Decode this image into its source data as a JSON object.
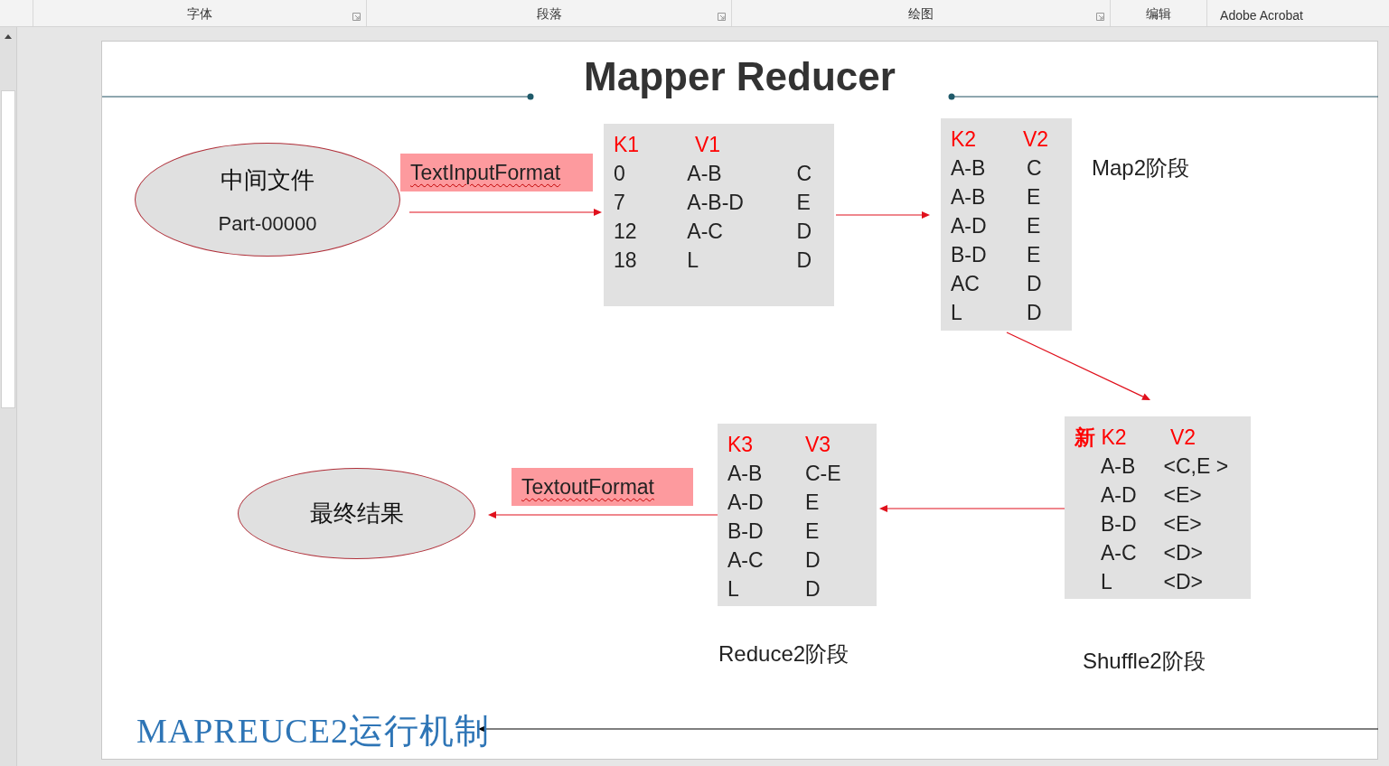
{
  "ribbon": {
    "groups": [
      {
        "label": "字体",
        "launcher": true
      },
      {
        "label": "段落",
        "launcher": true
      },
      {
        "label": "绘图",
        "launcher": true
      },
      {
        "label": "编辑",
        "launcher": false
      },
      {
        "label": "Adobe Acrobat",
        "launcher": false
      }
    ]
  },
  "slide": {
    "title": "Mapper Reducer",
    "ellipses": [
      {
        "title": "中间文件",
        "subtitle": "Part-00000"
      },
      {
        "title": "最终结果"
      }
    ],
    "format_labels": [
      "TextInputFormat",
      "TextoutFormat"
    ],
    "tables": [
      {
        "header": [
          "K1",
          "V1"
        ],
        "rows": [
          [
            "0",
            "A-B",
            "C"
          ],
          [
            "7",
            "A-B-D",
            "E"
          ],
          [
            "12",
            "A-C",
            "D"
          ],
          [
            "18",
            "L",
            "D"
          ]
        ]
      },
      {
        "header": [
          "K2",
          "V2"
        ],
        "rows": [
          [
            "A-B",
            "C"
          ],
          [
            "A-B",
            "E"
          ],
          [
            "A-D",
            "E"
          ],
          [
            "B-D",
            "E"
          ],
          [
            "AC",
            "D"
          ],
          [
            "L",
            "D"
          ]
        ]
      },
      {
        "header": [
          "K3",
          "V3"
        ],
        "rows": [
          [
            "A-B",
            "C-E"
          ],
          [
            "A-D",
            "E"
          ],
          [
            "B-D",
            "E"
          ],
          [
            "A-C",
            "D"
          ],
          [
            "L",
            "D"
          ]
        ]
      },
      {
        "header": [
          "**新** K2",
          "V2"
        ],
        "rows": [
          [
            "A-B",
            "<C,E >"
          ],
          [
            "A-D",
            "<E>"
          ],
          [
            "B-D",
            "<E>"
          ],
          [
            "A-C",
            "<D>"
          ],
          [
            "L",
            "<D>"
          ]
        ]
      }
    ],
    "captions": [
      "Map2阶段",
      "Reduce2阶段",
      "Shuffle2阶段"
    ],
    "footer_title": "MAPREUCE2运行机制"
  }
}
